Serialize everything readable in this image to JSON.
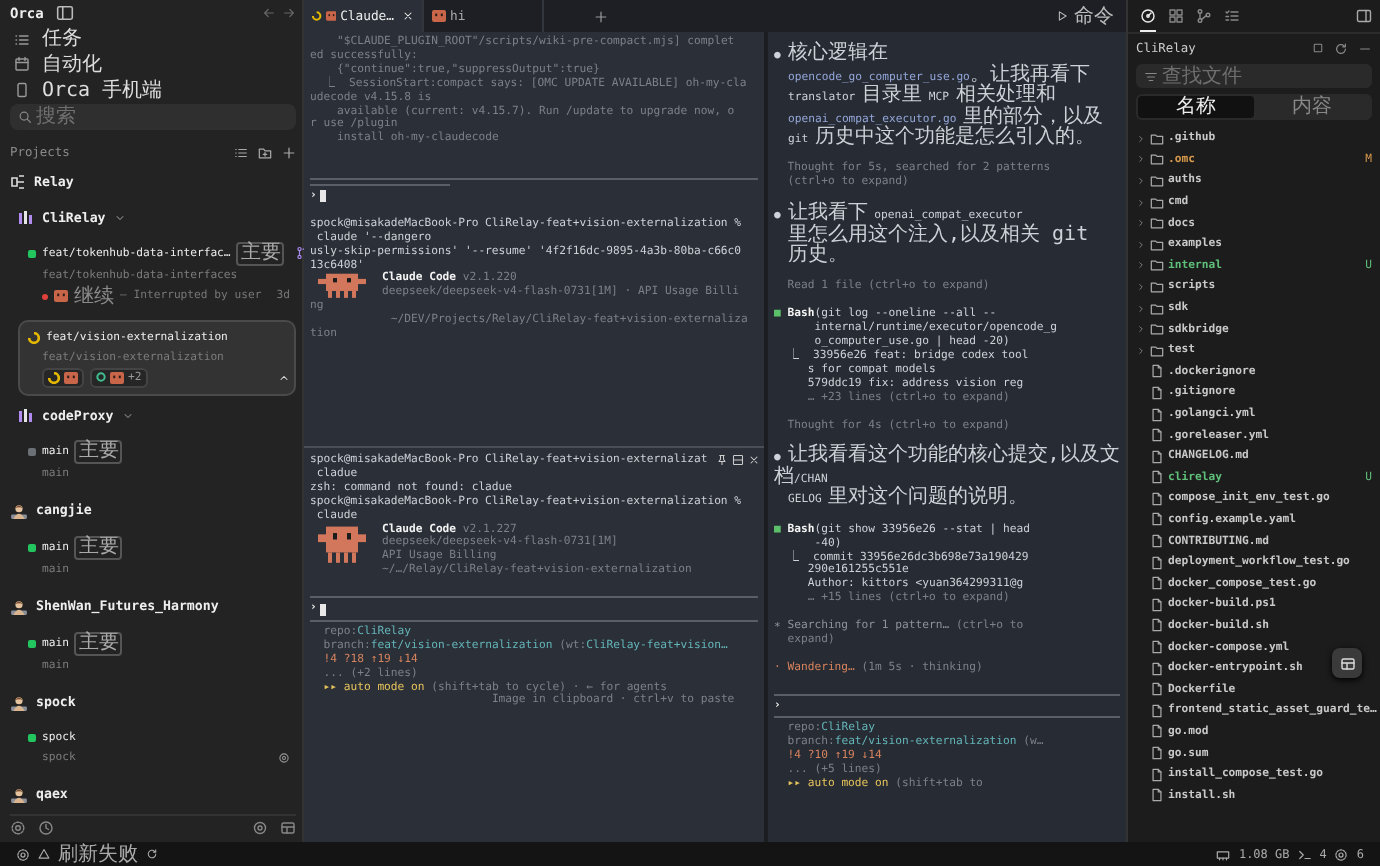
{
  "sidebar": {
    "title": "Orca",
    "nav": [
      {
        "label": "任务"
      },
      {
        "label": "自动化"
      },
      {
        "label": "Orca 手机端"
      }
    ],
    "search": {
      "placeholder": "搜索"
    },
    "projects_label": "Projects",
    "projects": [
      {
        "name": "Relay",
        "kind": "group",
        "children": [
          {
            "name": "CliRelay",
            "kind": "repo",
            "expanded": true,
            "children": [
              {
                "name": "feat/tokenhub-data-interfac…",
                "badge": "主要",
                "path": "feat/tokenhub-data-interfaces",
                "running": false,
                "color": "#22c55e",
                "selected": false,
                "pr": true,
                "indicator": false,
                "status": {
                  "title": "继续",
                  "text": "— Interrupted by user",
                  "age": "3d"
                }
              },
              {
                "name": "feat/vision-externalization",
                "path": "feat/vision-externalization",
                "running": true,
                "color": "#e5b800",
                "selected": true,
                "pr": false,
                "indicator": false,
                "extra": "+2"
              }
            ]
          },
          {
            "name": "codeProxy",
            "kind": "repo",
            "expanded": true,
            "children": [
              {
                "name": "main",
                "badge": "主要",
                "path": "main",
                "running": false,
                "color": "#6b6f76",
                "selected": false,
                "pr": false,
                "indicator": false
              }
            ]
          }
        ]
      },
      {
        "name": "cangjie",
        "kind": "project",
        "children": [
          {
            "name": "main",
            "badge": "主要",
            "path": "main",
            "running": false,
            "color": "#22c55e",
            "selected": false,
            "pr": false,
            "indicator": false
          }
        ]
      },
      {
        "name": "ShenWan_Futures_Harmony",
        "kind": "project",
        "children": [
          {
            "name": "main",
            "badge": "主要",
            "path": "main",
            "running": false,
            "color": "#22c55e",
            "selected": false,
            "pr": false,
            "indicator": false
          }
        ]
      },
      {
        "name": "spock",
        "kind": "project",
        "children": [
          {
            "name": "spock",
            "path": "spock",
            "running": false,
            "color": "#22c55e",
            "selected": false,
            "pr": false,
            "indicator": true
          }
        ]
      },
      {
        "name": "qaex",
        "kind": "project"
      }
    ]
  },
  "tabs": [
    {
      "label": "Claude…",
      "selected": true,
      "running": true
    },
    {
      "label": "hi",
      "selected": false,
      "running": false
    }
  ],
  "command_button": {
    "label": "命令"
  },
  "terminal": {
    "panes": [
      {
        "controls": false,
        "lines": [
          {
            "kind": "text",
            "parts": [
              {
                "text": "    \"$CLAUDE_PLUGIN_ROOT\"/scripts/wiki-pre-compact.mjs] complet",
                "color": "#7b808a"
              }
            ]
          },
          {
            "kind": "text",
            "parts": [
              {
                "text": "ed successfully:",
                "color": "#7b808a"
              }
            ]
          },
          {
            "kind": "text",
            "parts": [
              {
                "text": "    {\"continue\":true,\"suppressOutput\":true}",
                "color": "#7b808a"
              }
            ]
          },
          {
            "kind": "text",
            "parts": [
              {
                "text": "  ⎿  SessionStart:compact says: [OMC UPDATE AVAILABLE] oh-my-cla",
                "color": "#7b808a"
              }
            ]
          },
          {
            "kind": "text",
            "parts": [
              {
                "text": "udecode v4.15.8 is",
                "color": "#7b808a"
              }
            ]
          },
          {
            "kind": "text",
            "parts": [
              {
                "text": "    available (current: v4.15.7). Run /update to upgrade now, o",
                "color": "#7b808a"
              }
            ]
          },
          {
            "kind": "text",
            "parts": [
              {
                "text": "r use /plugin",
                "color": "#7b808a"
              }
            ]
          },
          {
            "kind": "text",
            "parts": [
              {
                "text": "    install oh-my-claudecode",
                "color": "#7b808a"
              }
            ]
          },
          {
            "kind": "blank"
          },
          {
            "kind": "blank"
          },
          {
            "kind": "rule"
          },
          {
            "kind": "rule_short"
          },
          {
            "kind": "prompt",
            "text": "›",
            "cursor": true
          },
          {
            "kind": "blank"
          },
          {
            "kind": "text",
            "parts": [
              {
                "text": "spock@misakadeMacBook-Pro CliRelay-feat+vision-externalization %",
                "color": "#cdd1d8"
              }
            ]
          },
          {
            "kind": "text",
            "parts": [
              {
                "text": " claude '--dangero",
                "color": "#cdd1d8"
              }
            ]
          },
          {
            "kind": "text",
            "parts": [
              {
                "text": "usly-skip-permissions' '--resume' '4f2f16dc-9895-4a3b-80ba-c66c0",
                "color": "#cdd1d8"
              }
            ]
          },
          {
            "kind": "text",
            "parts": [
              {
                "text": "13c6408'",
                "color": "#cdd1d8"
              }
            ]
          },
          {
            "kind": "banner",
            "lines": [
              {
                "kind": "text",
                "parts": [
                  {
                    "text": "Claude Code",
                    "color": "#f4f4f4",
                    "bold": true
                  },
                  {
                    "text": " v2.1.220",
                    "color": "#7b808a"
                  }
                ]
              },
              {
                "kind": "text",
                "parts": [
                  {
                    "text": "deepseek/deepseek-v4-flash-0731[1M] · API Usage Billi",
                    "color": "#7b808a"
                  }
                ]
              }
            ]
          },
          {
            "kind": "text",
            "parts": [
              {
                "text": "ng",
                "color": "#7b808a"
              }
            ]
          },
          {
            "kind": "text",
            "parts": [
              {
                "text": "            ~/DEV/Projects/Relay/CliRelay-feat+vision-externaliza",
                "color": "#7b808a"
              }
            ]
          },
          {
            "kind": "text",
            "parts": [
              {
                "text": "tion",
                "color": "#7b808a"
              }
            ]
          }
        ]
      },
      {
        "controls": true,
        "lines": [
          {
            "kind": "text",
            "parts": [
              {
                "text": "spock@misakadeMacBook-Pro CliRelay-feat+vision-externalizat",
                "color": "#cdd1d8"
              }
            ]
          },
          {
            "kind": "text",
            "parts": [
              {
                "text": " cladue",
                "color": "#cdd1d8"
              }
            ]
          },
          {
            "kind": "text",
            "parts": [
              {
                "text": "zsh: command not found: cladue",
                "color": "#cdd1d8"
              }
            ]
          },
          {
            "kind": "text",
            "parts": [
              {
                "text": "spock@misakadeMacBook-Pro CliRelay-feat+vision-externalization %",
                "color": "#cdd1d8"
              }
            ]
          },
          {
            "kind": "text",
            "parts": [
              {
                "text": " claude",
                "color": "#cdd1d8"
              }
            ]
          },
          {
            "kind": "banner",
            "lines": [
              {
                "kind": "text",
                "parts": [
                  {
                    "text": "Claude Code",
                    "color": "#f4f4f4",
                    "bold": true
                  },
                  {
                    "text": " v2.1.227",
                    "color": "#7b808a"
                  }
                ]
              },
              {
                "kind": "text",
                "parts": [
                  {
                    "text": "deepseek/deepseek-v4-flash-0731[1M]",
                    "color": "#7b808a"
                  }
                ]
              },
              {
                "kind": "text",
                "parts": [
                  {
                    "text": "API Usage Billing",
                    "color": "#7b808a"
                  }
                ]
              },
              {
                "kind": "text",
                "parts": [
                  {
                    "text": "~/…/Relay/CliRelay-feat+vision-externalization",
                    "color": "#7b808a"
                  }
                ]
              }
            ]
          },
          {
            "kind": "blank"
          },
          {
            "kind": "rule"
          },
          {
            "kind": "prompt",
            "text": "›",
            "cursor": true
          },
          {
            "kind": "rule"
          },
          {
            "kind": "text",
            "parts": [
              {
                "text": "  repo:",
                "color": "#7b808a"
              },
              {
                "text": "CliRelay",
                "color": "#63b5b8"
              }
            ]
          },
          {
            "kind": "text",
            "parts": [
              {
                "text": "  branch:",
                "color": "#7b808a"
              },
              {
                "text": "feat/vision-externalization",
                "color": "#63b5b8"
              },
              {
                "text": " (wt:",
                "color": "#7b808a"
              },
              {
                "text": "CliRelay-feat+vision…",
                "color": "#63b5b8"
              }
            ]
          },
          {
            "kind": "text",
            "parts": [
              {
                "text": "  !4 ?18 ↑19 ↓14",
                "color": "#d8845e"
              }
            ]
          },
          {
            "kind": "text",
            "parts": [
              {
                "text": "  ... (+2 lines)",
                "color": "#7b808a"
              }
            ]
          },
          {
            "kind": "text",
            "parts": [
              {
                "text": "  ▸▸ auto mode on",
                "color": "#e6c35c"
              },
              {
                "text": " (shift+tab to cycle) · ← for agents",
                "color": "#7b808a"
              }
            ]
          },
          {
            "kind": "text",
            "parts": [
              {
                "text": "                           Image in clipboard · ctrl+v to paste",
                "color": "#7b808a"
              }
            ]
          }
        ]
      }
    ],
    "side_pane": {
      "lines": [
        {
          "kind": "text",
          "parts": [
            {
              "text": "● ",
              "color": "#cdd1d8"
            },
            {
              "text": "核心逻辑在",
              "color": "#cdd1d8",
              "cjk": true
            }
          ]
        },
        {
          "kind": "text",
          "indent": true,
          "parts": [
            {
              "text": "opencode_go_computer_use.go",
              "color": "#93a6d9"
            },
            {
              "text": "。让我再看下",
              "color": "#cdd1d8",
              "cjk": true
            }
          ]
        },
        {
          "kind": "text",
          "indent": true,
          "parts": [
            {
              "text": "translator ",
              "color": "#cdd1d8"
            },
            {
              "text": "目录里",
              "color": "#cdd1d8",
              "cjk": true
            },
            {
              "text": " MCP ",
              "color": "#cdd1d8"
            },
            {
              "text": "相关处理和",
              "color": "#cdd1d8",
              "cjk": true
            }
          ]
        },
        {
          "kind": "text",
          "indent": true,
          "parts": [
            {
              "text": "openai_compat_executor.go ",
              "color": "#93a6d9"
            },
            {
              "text": "里的部分，以及",
              "color": "#cdd1d8",
              "cjk": true
            }
          ]
        },
        {
          "kind": "text",
          "indent": true,
          "parts": [
            {
              "text": "git ",
              "color": "#cdd1d8"
            },
            {
              "text": "历史中这个功能是怎么引入的。",
              "color": "#cdd1d8",
              "cjk": true
            }
          ]
        },
        {
          "kind": "blank"
        },
        {
          "kind": "text",
          "parts": [
            {
              "text": "  Thought for 5s, searched for 2 patterns",
              "color": "#7b808a"
            }
          ]
        },
        {
          "kind": "text",
          "parts": [
            {
              "text": "  (ctrl+o to expand)",
              "color": "#7b808a"
            }
          ]
        },
        {
          "kind": "blank"
        },
        {
          "kind": "text",
          "parts": [
            {
              "text": "● ",
              "color": "#cdd1d8"
            },
            {
              "text": "让我看下",
              "color": "#cdd1d8",
              "cjk": true
            },
            {
              "text": " openai_compat_executor",
              "color": "#cdd1d8"
            }
          ]
        },
        {
          "kind": "text",
          "indent": true,
          "parts": [
            {
              "text": "里怎么用这个注入,以及相关 git 历史。",
              "color": "#cdd1d8",
              "cjk": true
            }
          ]
        },
        {
          "kind": "blank"
        },
        {
          "kind": "text",
          "parts": [
            {
              "text": "  Read 1 file (ctrl+o to expand)",
              "color": "#7b808a"
            }
          ]
        },
        {
          "kind": "blank"
        },
        {
          "kind": "text",
          "parts": [
            {
              "text": "■ ",
              "color": "#5cbf6a"
            },
            {
              "text": "Bash",
              "color": "#f4f4f4",
              "bold": true
            },
            {
              "text": "(git log --oneline --all --",
              "color": "#cdd1d8"
            }
          ]
        },
        {
          "kind": "text",
          "parts": [
            {
              "text": "      internal/runtime/executor/opencode_g",
              "color": "#cdd1d8"
            }
          ]
        },
        {
          "kind": "text",
          "parts": [
            {
              "text": "      o_computer_use.go | head -20)",
              "color": "#cdd1d8"
            }
          ]
        },
        {
          "kind": "text",
          "parts": [
            {
              "text": "  ⎿  33956e26 feat: bridge codex tool",
              "color": "#cdd1d8"
            }
          ]
        },
        {
          "kind": "text",
          "parts": [
            {
              "text": "     s for compat models",
              "color": "#cdd1d8"
            }
          ]
        },
        {
          "kind": "text",
          "parts": [
            {
              "text": "     579ddc19 fix: address vision reg",
              "color": "#cdd1d8"
            }
          ]
        },
        {
          "kind": "text",
          "parts": [
            {
              "text": "     … +23 lines (ctrl+o to expand)",
              "color": "#7b808a"
            }
          ]
        },
        {
          "kind": "blank"
        },
        {
          "kind": "text",
          "parts": [
            {
              "text": "  Thought for 4s (ctrl+o to expand)",
              "color": "#7b808a"
            }
          ]
        },
        {
          "kind": "blank"
        },
        {
          "kind": "text",
          "parts": [
            {
              "text": "● ",
              "color": "#cdd1d8"
            },
            {
              "text": "让我看看这个功能的核心提交,以及文档",
              "color": "#cdd1d8",
              "cjk": true
            },
            {
              "text": "/CHAN",
              "color": "#cdd1d8"
            }
          ]
        },
        {
          "kind": "text",
          "indent": true,
          "parts": [
            {
              "text": "GELOG ",
              "color": "#cdd1d8"
            },
            {
              "text": "里对这个问题的说明。",
              "color": "#cdd1d8",
              "cjk": true
            }
          ]
        },
        {
          "kind": "blank"
        },
        {
          "kind": "text",
          "parts": [
            {
              "text": "■ ",
              "color": "#5cbf6a"
            },
            {
              "text": "Bash",
              "color": "#f4f4f4",
              "bold": true
            },
            {
              "text": "(git show 33956e26 --stat | head",
              "color": "#cdd1d8"
            }
          ]
        },
        {
          "kind": "text",
          "parts": [
            {
              "text": "      -40)",
              "color": "#cdd1d8"
            }
          ]
        },
        {
          "kind": "text",
          "parts": [
            {
              "text": "  ⎿  commit 33956e26dc3b698e73a190429",
              "color": "#cdd1d8"
            }
          ]
        },
        {
          "kind": "text",
          "parts": [
            {
              "text": "     290e161255c551e",
              "color": "#cdd1d8"
            }
          ]
        },
        {
          "kind": "text",
          "parts": [
            {
              "text": "     Author: kittors <yuan364299311@g",
              "color": "#cdd1d8"
            }
          ]
        },
        {
          "kind": "text",
          "parts": [
            {
              "text": "     … +15 lines (ctrl+o to expand)",
              "color": "#7b808a"
            }
          ]
        },
        {
          "kind": "blank"
        },
        {
          "kind": "text",
          "parts": [
            {
              "text": "∗ Searching for 1 pattern… ",
              "color": "#8d929b"
            },
            {
              "text": "(ctrl+o to",
              "color": "#7b808a"
            }
          ]
        },
        {
          "kind": "text",
          "parts": [
            {
              "text": "  expand)",
              "color": "#7b808a"
            }
          ]
        },
        {
          "kind": "blank"
        },
        {
          "kind": "text",
          "parts": [
            {
              "text": "· Wandering…",
              "color": "#d8845e"
            },
            {
              "text": " (1m 5s · thinking)",
              "color": "#7b808a"
            }
          ]
        },
        {
          "kind": "blank"
        },
        {
          "kind": "rule"
        },
        {
          "kind": "prompt",
          "text": "›",
          "cursor": false
        },
        {
          "kind": "rule"
        },
        {
          "kind": "text",
          "parts": [
            {
              "text": "  repo:",
              "color": "#7b808a"
            },
            {
              "text": "CliRelay",
              "color": "#63b5b8"
            }
          ]
        },
        {
          "kind": "text",
          "parts": [
            {
              "text": "  branch:",
              "color": "#7b808a"
            },
            {
              "text": "feat/vision-externalization",
              "color": "#63b5b8"
            },
            {
              "text": " (w…",
              "color": "#7b808a"
            }
          ]
        },
        {
          "kind": "text",
          "parts": [
            {
              "text": "  !4 ?10 ↑19 ↓14",
              "color": "#d8845e"
            }
          ]
        },
        {
          "kind": "text",
          "parts": [
            {
              "text": "  ... (+5 lines)",
              "color": "#7b808a"
            }
          ]
        },
        {
          "kind": "text",
          "parts": [
            {
              "text": "  ▸▸ auto mode on",
              "color": "#e6c35c"
            },
            {
              "text": " (shift+tab to",
              "color": "#7b808a"
            }
          ]
        }
      ]
    }
  },
  "files": {
    "tabs": [
      {
        "selected": true
      },
      {
        "selected": false
      },
      {
        "selected": false
      },
      {
        "selected": false
      }
    ],
    "title": "CliRelay",
    "search": {
      "placeholder": "查找文件"
    },
    "modes": [
      {
        "label": "名称",
        "selected": true
      },
      {
        "label": "内容",
        "selected": false
      }
    ],
    "items": [
      {
        "name": ".github",
        "kind": "folder",
        "color": "#c9c9c9",
        "expanded": false
      },
      {
        "name": ".omc",
        "kind": "folder",
        "color": "#d99a4e",
        "badge": "M",
        "expanded": false
      },
      {
        "name": "auths",
        "kind": "folder",
        "color": "#c9c9c9",
        "expanded": false
      },
      {
        "name": "cmd",
        "kind": "folder",
        "color": "#c9c9c9",
        "expanded": false
      },
      {
        "name": "docs",
        "kind": "folder",
        "color": "#c9c9c9",
        "expanded": false
      },
      {
        "name": "examples",
        "kind": "folder",
        "color": "#c9c9c9",
        "expanded": false
      },
      {
        "name": "internal",
        "kind": "folder",
        "color": "#5fbf7a",
        "badge": "U",
        "expanded": false
      },
      {
        "name": "scripts",
        "kind": "folder",
        "color": "#c9c9c9",
        "expanded": false
      },
      {
        "name": "sdk",
        "kind": "folder",
        "color": "#c9c9c9",
        "expanded": false
      },
      {
        "name": "sdkbridge",
        "kind": "folder",
        "color": "#c9c9c9",
        "expanded": false
      },
      {
        "name": "test",
        "kind": "folder",
        "color": "#c9c9c9",
        "expanded": false
      },
      {
        "name": ".dockerignore",
        "kind": "file",
        "color": "#c9c9c9"
      },
      {
        "name": ".gitignore",
        "kind": "file",
        "color": "#c9c9c9"
      },
      {
        "name": ".golangci.yml",
        "kind": "file",
        "color": "#c9c9c9"
      },
      {
        "name": ".goreleaser.yml",
        "kind": "file",
        "color": "#c9c9c9"
      },
      {
        "name": "CHANGELOG.md",
        "kind": "file",
        "color": "#c9c9c9"
      },
      {
        "name": "clirelay",
        "kind": "file",
        "color": "#5fbf7a",
        "badge": "U"
      },
      {
        "name": "compose_init_env_test.go",
        "kind": "file",
        "color": "#c9c9c9"
      },
      {
        "name": "config.example.yaml",
        "kind": "file",
        "color": "#c9c9c9"
      },
      {
        "name": "CONTRIBUTING.md",
        "kind": "file",
        "color": "#c9c9c9"
      },
      {
        "name": "deployment_workflow_test.go",
        "kind": "file",
        "color": "#c9c9c9"
      },
      {
        "name": "docker_compose_test.go",
        "kind": "file",
        "color": "#c9c9c9"
      },
      {
        "name": "docker-build.ps1",
        "kind": "file",
        "color": "#c9c9c9"
      },
      {
        "name": "docker-build.sh",
        "kind": "file",
        "color": "#c9c9c9"
      },
      {
        "name": "docker-compose.yml",
        "kind": "file",
        "color": "#c9c9c9"
      },
      {
        "name": "docker-entrypoint.sh",
        "kind": "file",
        "color": "#c9c9c9"
      },
      {
        "name": "Dockerfile",
        "kind": "file",
        "color": "#c9c9c9"
      },
      {
        "name": "frontend_static_asset_guard_te…",
        "kind": "file",
        "color": "#c9c9c9"
      },
      {
        "name": "go.mod",
        "kind": "file",
        "color": "#c9c9c9"
      },
      {
        "name": "go.sum",
        "kind": "file",
        "color": "#c9c9c9"
      },
      {
        "name": "install_compose_test.go",
        "kind": "file",
        "color": "#c9c9c9"
      },
      {
        "name": "install.sh",
        "kind": "file",
        "color": "#c9c9c9"
      }
    ]
  },
  "status_bar": {
    "message": "刷新失败",
    "memory": "1.08 GB",
    "terminals": "4",
    "ports": "6"
  }
}
